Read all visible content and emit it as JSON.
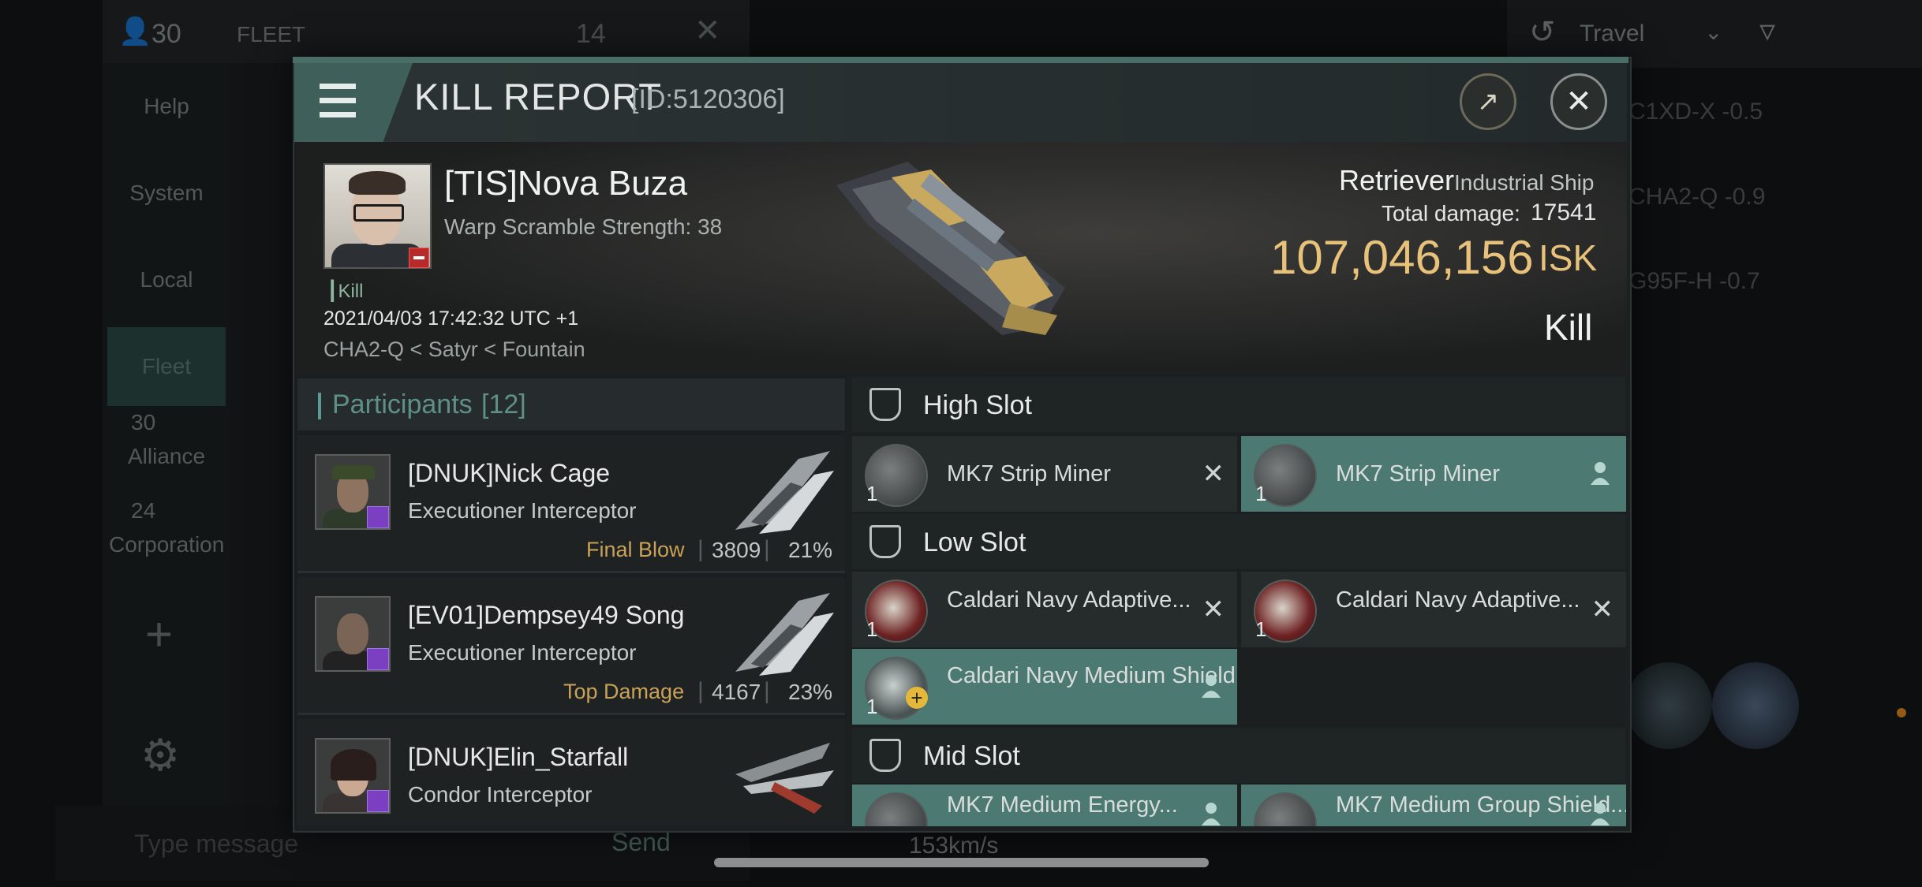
{
  "background": {
    "top_count": "30",
    "fleet_label": "FLEET",
    "fleet_count": "14",
    "sidebar": [
      "Help",
      "System",
      "Local",
      "Fleet"
    ],
    "alliance_count": "30",
    "alliance_label": "Alliance",
    "corp_count": "24",
    "corp_label": "Corporation",
    "chat_placeholder": "Type message",
    "send_label": "Send",
    "travel_label": "Travel",
    "speed": "153km/s",
    "systems": [
      "C1XD-X -0.5",
      "CHA2-Q -0.9",
      "G95F-H -0.7"
    ]
  },
  "header": {
    "title": "KILL REPORT",
    "id": "[ID:5120306]"
  },
  "victim": {
    "name": "[TIS]Nova Buza",
    "warp_scramble": "Warp Scramble Strength: 38",
    "kill_tag": "Kill",
    "datetime": "2021/04/03 17:42:32 UTC +1",
    "location": "CHA2-Q < Satyr < Fountain",
    "ship_name": "Retriever",
    "ship_class": "Industrial Ship",
    "total_damage_label": "Total damage:",
    "total_damage": "17541",
    "isk_value": "107,046,156",
    "isk_unit": "ISK",
    "result": "Kill"
  },
  "participants": {
    "title": "Participants",
    "count": "[12]",
    "rows": [
      {
        "name": "[DNUK]Nick Cage",
        "ship": "Executioner Interceptor",
        "tag": "Final Blow",
        "damage": "3809",
        "percent": "21%"
      },
      {
        "name": "[EV01]Dempsey49 Song",
        "ship": "Executioner Interceptor",
        "tag": "Top Damage",
        "damage": "4167",
        "percent": "23%"
      },
      {
        "name": "[DNUK]Elin_Starfall",
        "ship": "Condor Interceptor",
        "tag": "",
        "damage": "",
        "percent": ""
      }
    ]
  },
  "fitting": {
    "high_slot": "High Slot",
    "low_slot": "Low Slot",
    "mid_slot": "Mid Slot",
    "high": [
      {
        "name": "MK7 Strip Miner",
        "qty": "1",
        "state": "destroyed"
      },
      {
        "name": "MK7 Strip Miner",
        "qty": "1",
        "state": "dropped"
      }
    ],
    "low": [
      {
        "name": "Caldari Navy Adaptive...",
        "qty": "1",
        "state": "destroyed"
      },
      {
        "name": "Caldari Navy Adaptive...",
        "qty": "1",
        "state": "destroyed"
      },
      {
        "name": "Caldari Navy Medium Shield ...",
        "qty": "1",
        "state": "dropped"
      }
    ],
    "mid": [
      {
        "name": "MK7 Medium Energy...",
        "qty": "",
        "state": "dropped"
      },
      {
        "name": "MK7 Medium Group Shield...",
        "qty": "",
        "state": "dropped"
      }
    ]
  },
  "colors": {
    "accent": "#4c7a72",
    "gold": "#e8c27a",
    "tag_gold": "#c9a257",
    "purple": "#7b3fc2"
  }
}
